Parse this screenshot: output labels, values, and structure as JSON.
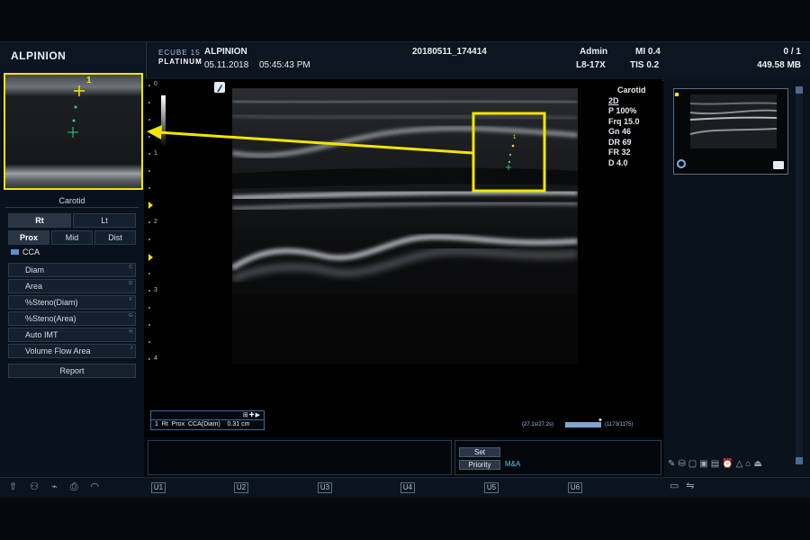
{
  "header": {
    "brand_left": "ALPINION",
    "ecube_line1": "ECUBE 15",
    "ecube_line2": "PLATINUM",
    "institution": "ALPINION",
    "date": "05.11.2018",
    "time": "05:45:43  PM",
    "patient_id": "20180511_174414",
    "user": "Admin",
    "probe": "L8-17X",
    "mi": "MI 0.4",
    "tis": "TIS 0.2",
    "image_count": "0 / 1",
    "storage": "449.58 MB"
  },
  "left_panel": {
    "title": "Carotid",
    "side_buttons": [
      "Rt",
      "Lt"
    ],
    "segment_buttons": [
      "Prox",
      "Mid",
      "Dist"
    ],
    "vessel": "CCA",
    "measures": [
      {
        "label": "Diam",
        "hotkey": "C"
      },
      {
        "label": "Area",
        "hotkey": "D"
      },
      {
        "label": "%Steno(Diam)",
        "hotkey": "F"
      },
      {
        "label": "%Steno(Area)",
        "hotkey": "G"
      },
      {
        "label": "Auto IMT",
        "hotkey": "H"
      },
      {
        "label": "Volume Flow Area",
        "hotkey": "J"
      }
    ],
    "report_label": "Report"
  },
  "depth_scale": [
    "0",
    "1",
    "2",
    "3",
    "4"
  ],
  "zoom_marker": "1",
  "imaging_params": {
    "preset": "Carotid",
    "mode": "2D",
    "lines": [
      "P 100%",
      "Frq 15.0",
      "Gn 46",
      "DR 69",
      "FR 32",
      "D 4.0"
    ]
  },
  "measurement": {
    "text": "1  Rt  Prox  CCA(Diam)    0.31 cm"
  },
  "cine": {
    "time": "(27.1s/27.2s)",
    "frames": "(1173/1175)"
  },
  "lower_panel": {
    "set_label": "Set",
    "priority_label": "Priority",
    "mode_label": "M&A"
  },
  "u_keys": [
    "U1",
    "U2",
    "U3",
    "U4",
    "U5",
    "U6"
  ],
  "colors": {
    "highlight": "#f2e600",
    "caliper_green": "#34d27a",
    "background": "#05080d",
    "panel": "#0c1520"
  }
}
